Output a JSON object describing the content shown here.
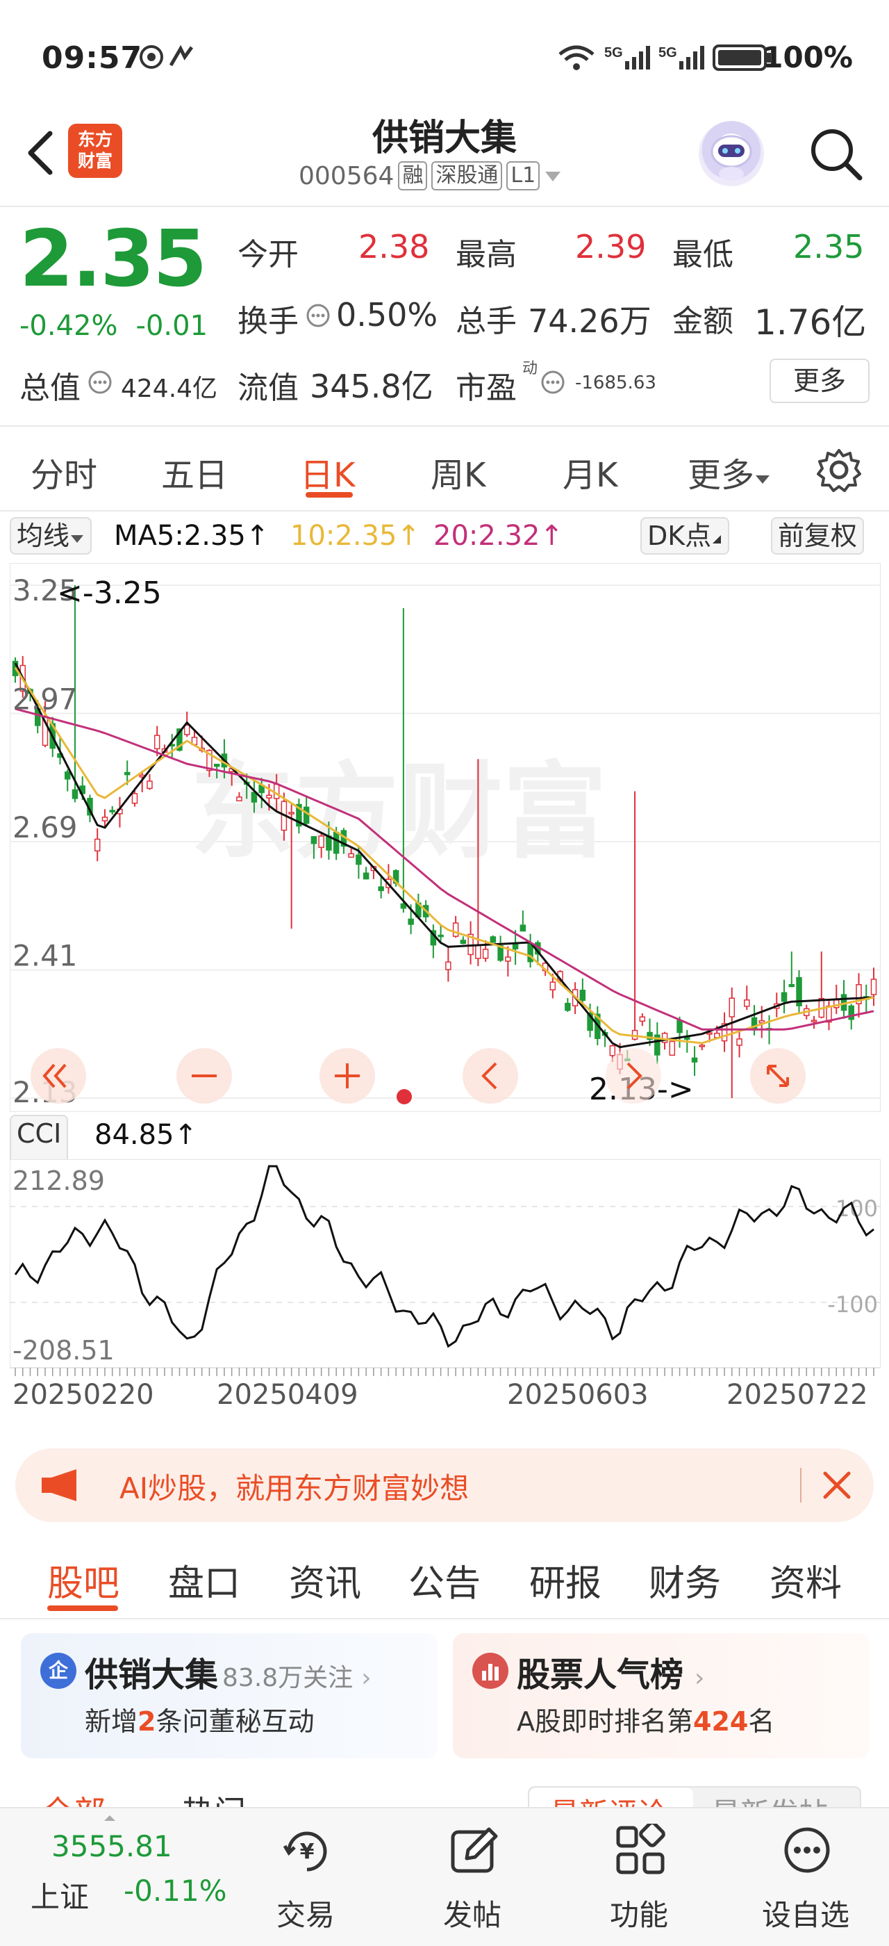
{
  "status_bar": {
    "time": "09:57",
    "signal": "5G",
    "battery": "100%"
  },
  "header": {
    "title": "供销大集",
    "code": "000564",
    "tags": [
      "融",
      "深股通",
      "L1"
    ],
    "logo_text": "东方财富"
  },
  "quote": {
    "price": "2.35",
    "change_pct": "-0.42%",
    "change_abs": "-0.01",
    "fields": [
      {
        "label": "今开",
        "value": "2.38",
        "tone": "red"
      },
      {
        "label": "最高",
        "value": "2.39",
        "tone": "red"
      },
      {
        "label": "最低",
        "value": "2.35",
        "tone": "green"
      },
      {
        "label": "换手",
        "value": "0.50%",
        "tone": "plain"
      },
      {
        "label": "总手",
        "value": "74.26万",
        "tone": "plain"
      },
      {
        "label": "金额",
        "value": "1.76亿",
        "tone": "plain"
      },
      {
        "label": "总值",
        "value": "424.4亿",
        "tone": "plain"
      },
      {
        "label": "流值",
        "value": "345.8亿",
        "tone": "plain"
      },
      {
        "label": "市盈",
        "value": "-1685.63",
        "tone": "plain"
      }
    ],
    "pe_superscript": "动",
    "more_label": "更多"
  },
  "chart_tabs": [
    "分时",
    "五日",
    "日K",
    "周K",
    "月K",
    "更多"
  ],
  "active_chart_tab": 2,
  "ma_row": {
    "type_label": "均线",
    "ma5": "MA5:2.35",
    "ma10": "10:2.35",
    "ma20": "20:2.32",
    "dk_label": "DK点",
    "adjust_label": "前复权"
  },
  "kline": {
    "y_ticks": [
      "3.25",
      "2.97",
      "2.69",
      "2.41",
      "2.13"
    ],
    "max_label": "<-3.25",
    "min_label": "2.13->",
    "watermark": "东方财富",
    "colors": {
      "up": "#e0303a",
      "down": "#1e9a38",
      "ma5": "#111111",
      "ma10": "#e8b838",
      "ma20": "#c2307a"
    }
  },
  "cci": {
    "label": "CCI",
    "value": "84.85",
    "y_top": "212.89",
    "y_bottom": "-208.51",
    "ref_high": "100",
    "ref_low": "-100",
    "dates": [
      "20250220",
      "20250409",
      "20250603",
      "20250722"
    ]
  },
  "chart_data": [
    {
      "type": "line",
      "title": "",
      "xlabel": "",
      "ylabel": "",
      "ylim": [
        2.13,
        3.25
      ],
      "x": [
        "20250220",
        "20250409",
        "20250603",
        "20250722"
      ],
      "series": [
        {
          "name": "MA5",
          "values": [
            3.08,
            2.71,
            2.95,
            2.76,
            2.67,
            2.46,
            2.47,
            2.24,
            2.27,
            2.34,
            2.35
          ]
        },
        {
          "name": "10",
          "values": [
            3.07,
            2.78,
            2.91,
            2.8,
            2.68,
            2.5,
            2.44,
            2.27,
            2.25,
            2.31,
            2.35
          ]
        },
        {
          "name": "20",
          "values": [
            2.98,
            2.93,
            2.86,
            2.82,
            2.74,
            2.58,
            2.47,
            2.36,
            2.28,
            2.28,
            2.32
          ]
        }
      ]
    },
    {
      "type": "line",
      "title": "",
      "ylim": [
        -208.51,
        212.89
      ],
      "x": [
        "20250220",
        "20250409",
        "20250603",
        "20250722"
      ],
      "series": [
        {
          "name": "CCI",
          "values": [
            -35,
            95,
            -165,
            210,
            -12,
            -150,
            -50,
            -125,
            45,
            145,
            85
          ]
        }
      ]
    }
  ],
  "ad": {
    "text": "AI炒股，就用东方财富妙想"
  },
  "sub_tabs": [
    "股吧",
    "盘口",
    "资讯",
    "公告",
    "研报",
    "财务",
    "资料"
  ],
  "active_sub_tab": 0,
  "cards": {
    "left": {
      "icon": "企",
      "title": "供销大集",
      "followers": "83.8万关注",
      "sub_pre": "新增",
      "sub_num": "2",
      "sub_post": "条问董秘互动"
    },
    "right": {
      "title": "股票人气榜",
      "sub_pre": "A股即时排名第",
      "sub_num": "424",
      "sub_post": "名"
    }
  },
  "peek": {
    "a": "全部",
    "b": "热门",
    "c": "最新评论",
    "d": "最新发帖"
  },
  "bottom_nav": {
    "index_value": "3555.81",
    "index_name": "上证",
    "index_change": "-0.11%",
    "items": [
      "交易",
      "发帖",
      "功能",
      "设自选"
    ]
  }
}
